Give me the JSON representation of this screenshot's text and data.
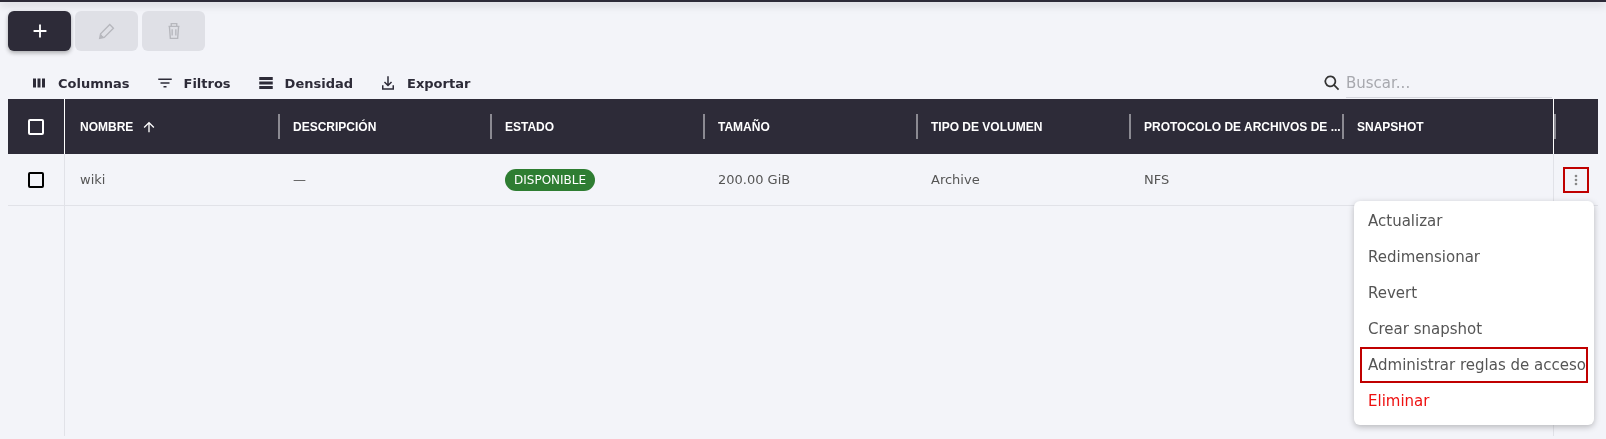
{
  "toolbar_buttons": [
    {
      "kind": "add",
      "disabled": false
    },
    {
      "kind": "edit",
      "disabled": true
    },
    {
      "kind": "delete",
      "disabled": true
    }
  ],
  "grid_toolbar": [
    {
      "kind": "columns",
      "label": "Columnas"
    },
    {
      "kind": "filters",
      "label": "Filtros"
    },
    {
      "kind": "density",
      "label": "Densidad"
    },
    {
      "kind": "export",
      "label": "Exportar"
    }
  ],
  "search": {
    "placeholder": "Buscar..."
  },
  "table": {
    "select_all_checked": false,
    "columns": [
      {
        "label": "NOMBRE",
        "sorted": true
      },
      {
        "label": "DESCRIPCIÓN",
        "sorted": false
      },
      {
        "label": "ESTADO",
        "sorted": false
      },
      {
        "label": "TAMAÑO",
        "sorted": false
      },
      {
        "label": "TIPO DE VOLUMEN",
        "sorted": false
      },
      {
        "label": "PROTOCOLO DE ARCHIVOS DE ...",
        "sorted": false
      },
      {
        "label": "SNAPSHOT",
        "sorted": false
      }
    ],
    "rows": [
      {
        "checked": false,
        "actions_highlighted": true,
        "cells": [
          {
            "kind": "text",
            "text": "wiki"
          },
          {
            "kind": "text",
            "text": "—"
          },
          {
            "kind": "status",
            "text": "DISPONIBLE",
            "color": "#2e7d32"
          },
          {
            "kind": "text",
            "text": "200.00 GiB"
          },
          {
            "kind": "text",
            "text": "Archive"
          },
          {
            "kind": "text",
            "text": "NFS"
          }
        ]
      }
    ]
  },
  "menu": {
    "items": [
      {
        "label": "Actualizar",
        "kind": "normal",
        "highlighted": false
      },
      {
        "label": "Redimensionar",
        "kind": "normal",
        "highlighted": false
      },
      {
        "label": "Revert",
        "kind": "normal",
        "highlighted": false
      },
      {
        "label": "Crear snapshot",
        "kind": "normal",
        "highlighted": false
      },
      {
        "label": "Administrar reglas de acceso",
        "kind": "normal",
        "highlighted": true
      },
      {
        "label": "Eliminar",
        "kind": "danger",
        "highlighted": false
      }
    ]
  }
}
